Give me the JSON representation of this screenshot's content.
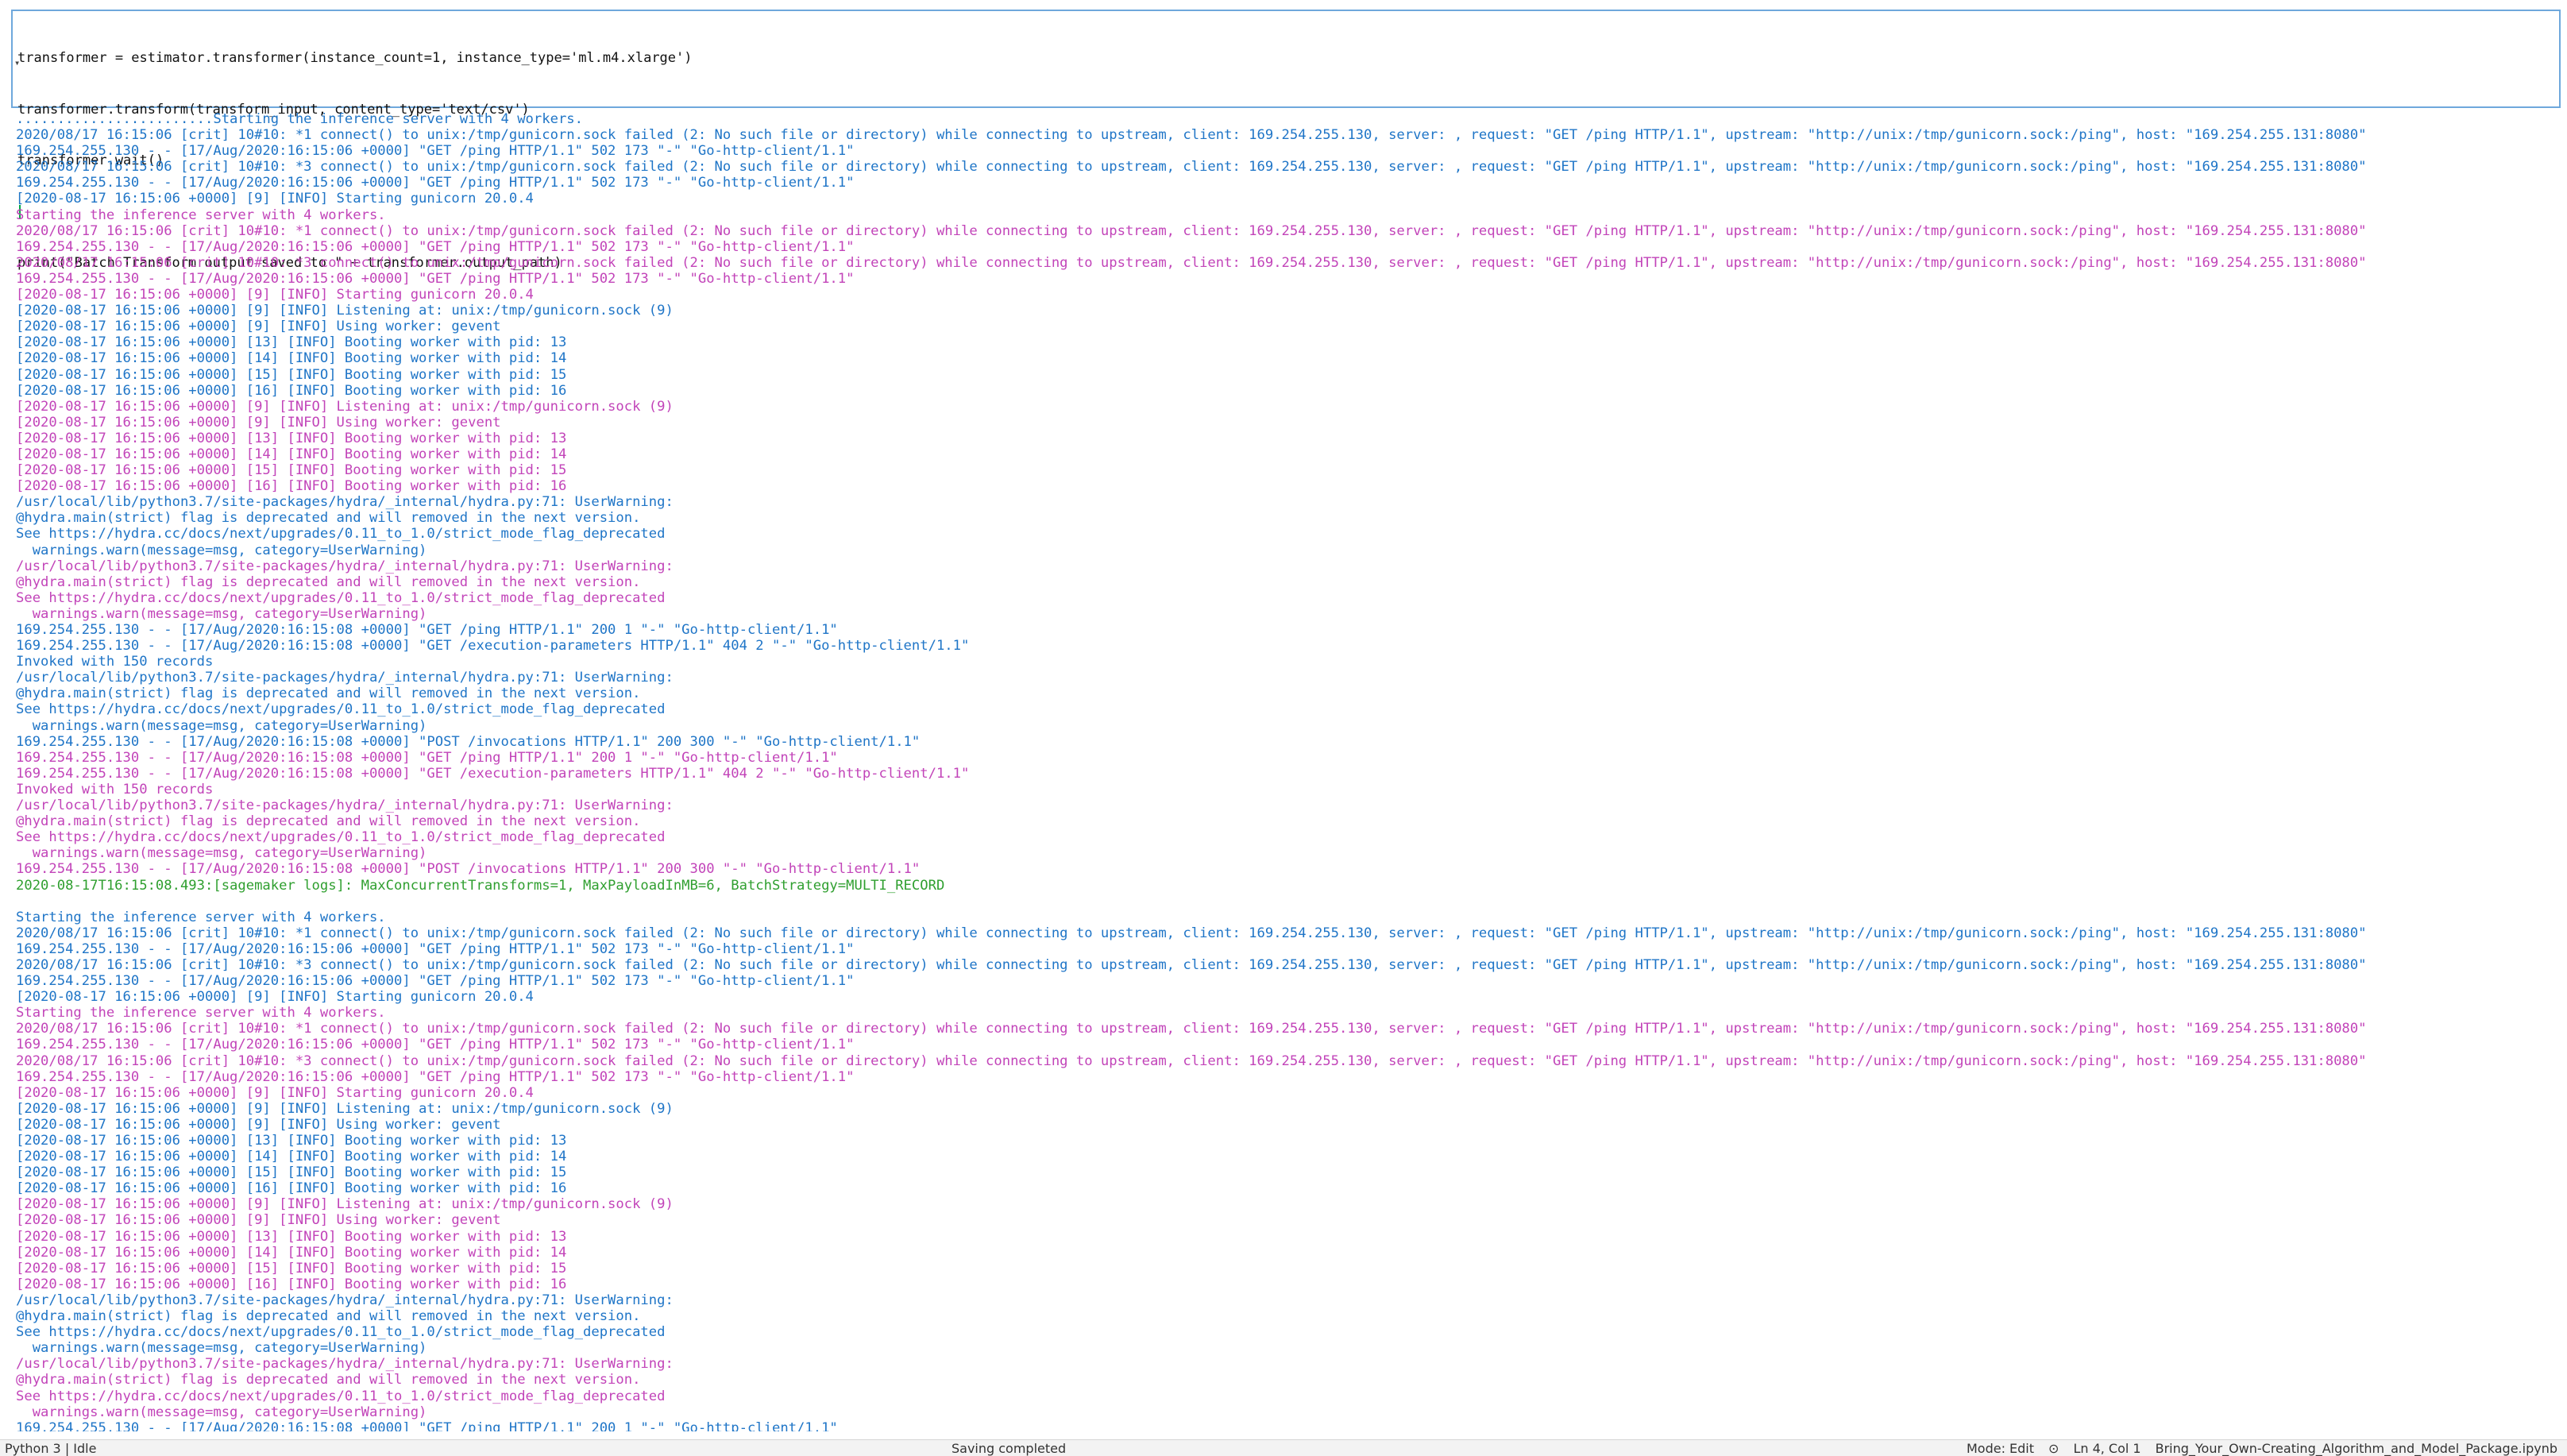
{
  "cell": {
    "code_lines": [
      "transformer = estimator.transformer(instance_count=1, instance_type='ml.m4.xlarge')",
      "transformer.transform(transform_input, content_type='text/csv')",
      "transformer.wait()",
      "",
      "print(\"Batch Transform output saved to \" + transformer.output_path)"
    ]
  },
  "output": {
    "lines": [
      {
        "text": "........................Starting the inference server with 4 workers.",
        "color": "blue"
      },
      {
        "text": "2020/08/17 16:15:06 [crit] 10#10: *1 connect() to unix:/tmp/gunicorn.sock failed (2: No such file or directory) while connecting to upstream, client: 169.254.255.130, server: , request: \"GET /ping HTTP/1.1\", upstream: \"http://unix:/tmp/gunicorn.sock:/ping\", host: \"169.254.255.131:8080\"",
        "color": "blue"
      },
      {
        "text": "169.254.255.130 - - [17/Aug/2020:16:15:06 +0000] \"GET /ping HTTP/1.1\" 502 173 \"-\" \"Go-http-client/1.1\"",
        "color": "blue"
      },
      {
        "text": "2020/08/17 16:15:06 [crit] 10#10: *3 connect() to unix:/tmp/gunicorn.sock failed (2: No such file or directory) while connecting to upstream, client: 169.254.255.130, server: , request: \"GET /ping HTTP/1.1\", upstream: \"http://unix:/tmp/gunicorn.sock:/ping\", host: \"169.254.255.131:8080\"",
        "color": "blue"
      },
      {
        "text": "169.254.255.130 - - [17/Aug/2020:16:15:06 +0000] \"GET /ping HTTP/1.1\" 502 173 \"-\" \"Go-http-client/1.1\"",
        "color": "blue"
      },
      {
        "text": "[2020-08-17 16:15:06 +0000] [9] [INFO] Starting gunicorn 20.0.4",
        "color": "blue"
      },
      {
        "text": "Starting the inference server with 4 workers.",
        "color": "mag"
      },
      {
        "text": "2020/08/17 16:15:06 [crit] 10#10: *1 connect() to unix:/tmp/gunicorn.sock failed (2: No such file or directory) while connecting to upstream, client: 169.254.255.130, server: , request: \"GET /ping HTTP/1.1\", upstream: \"http://unix:/tmp/gunicorn.sock:/ping\", host: \"169.254.255.131:8080\"",
        "color": "mag"
      },
      {
        "text": "169.254.255.130 - - [17/Aug/2020:16:15:06 +0000] \"GET /ping HTTP/1.1\" 502 173 \"-\" \"Go-http-client/1.1\"",
        "color": "mag"
      },
      {
        "text": "2020/08/17 16:15:06 [crit] 10#10: *3 connect() to unix:/tmp/gunicorn.sock failed (2: No such file or directory) while connecting to upstream, client: 169.254.255.130, server: , request: \"GET /ping HTTP/1.1\", upstream: \"http://unix:/tmp/gunicorn.sock:/ping\", host: \"169.254.255.131:8080\"",
        "color": "mag"
      },
      {
        "text": "169.254.255.130 - - [17/Aug/2020:16:15:06 +0000] \"GET /ping HTTP/1.1\" 502 173 \"-\" \"Go-http-client/1.1\"",
        "color": "mag"
      },
      {
        "text": "[2020-08-17 16:15:06 +0000] [9] [INFO] Starting gunicorn 20.0.4",
        "color": "mag"
      },
      {
        "text": "[2020-08-17 16:15:06 +0000] [9] [INFO] Listening at: unix:/tmp/gunicorn.sock (9)",
        "color": "blue"
      },
      {
        "text": "[2020-08-17 16:15:06 +0000] [9] [INFO] Using worker: gevent",
        "color": "blue"
      },
      {
        "text": "[2020-08-17 16:15:06 +0000] [13] [INFO] Booting worker with pid: 13",
        "color": "blue"
      },
      {
        "text": "[2020-08-17 16:15:06 +0000] [14] [INFO] Booting worker with pid: 14",
        "color": "blue"
      },
      {
        "text": "[2020-08-17 16:15:06 +0000] [15] [INFO] Booting worker with pid: 15",
        "color": "blue"
      },
      {
        "text": "[2020-08-17 16:15:06 +0000] [16] [INFO] Booting worker with pid: 16",
        "color": "blue"
      },
      {
        "text": "[2020-08-17 16:15:06 +0000] [9] [INFO] Listening at: unix:/tmp/gunicorn.sock (9)",
        "color": "mag"
      },
      {
        "text": "[2020-08-17 16:15:06 +0000] [9] [INFO] Using worker: gevent",
        "color": "mag"
      },
      {
        "text": "[2020-08-17 16:15:06 +0000] [13] [INFO] Booting worker with pid: 13",
        "color": "mag"
      },
      {
        "text": "[2020-08-17 16:15:06 +0000] [14] [INFO] Booting worker with pid: 14",
        "color": "mag"
      },
      {
        "text": "[2020-08-17 16:15:06 +0000] [15] [INFO] Booting worker with pid: 15",
        "color": "mag"
      },
      {
        "text": "[2020-08-17 16:15:06 +0000] [16] [INFO] Booting worker with pid: 16",
        "color": "mag"
      },
      {
        "text": "/usr/local/lib/python3.7/site-packages/hydra/_internal/hydra.py:71: UserWarning:",
        "color": "blue"
      },
      {
        "text": "@hydra.main(strict) flag is deprecated and will removed in the next version.",
        "color": "blue"
      },
      {
        "text": "See https://hydra.cc/docs/next/upgrades/0.11_to_1.0/strict_mode_flag_deprecated",
        "color": "blue"
      },
      {
        "text": "  warnings.warn(message=msg, category=UserWarning)",
        "color": "blue"
      },
      {
        "text": "/usr/local/lib/python3.7/site-packages/hydra/_internal/hydra.py:71: UserWarning:",
        "color": "mag"
      },
      {
        "text": "@hydra.main(strict) flag is deprecated and will removed in the next version.",
        "color": "mag"
      },
      {
        "text": "See https://hydra.cc/docs/next/upgrades/0.11_to_1.0/strict_mode_flag_deprecated",
        "color": "mag"
      },
      {
        "text": "  warnings.warn(message=msg, category=UserWarning)",
        "color": "mag"
      },
      {
        "text": "169.254.255.130 - - [17/Aug/2020:16:15:08 +0000] \"GET /ping HTTP/1.1\" 200 1 \"-\" \"Go-http-client/1.1\"",
        "color": "blue"
      },
      {
        "text": "169.254.255.130 - - [17/Aug/2020:16:15:08 +0000] \"GET /execution-parameters HTTP/1.1\" 404 2 \"-\" \"Go-http-client/1.1\"",
        "color": "blue"
      },
      {
        "text": "Invoked with 150 records",
        "color": "blue"
      },
      {
        "text": "/usr/local/lib/python3.7/site-packages/hydra/_internal/hydra.py:71: UserWarning:",
        "color": "blue"
      },
      {
        "text": "@hydra.main(strict) flag is deprecated and will removed in the next version.",
        "color": "blue"
      },
      {
        "text": "See https://hydra.cc/docs/next/upgrades/0.11_to_1.0/strict_mode_flag_deprecated",
        "color": "blue"
      },
      {
        "text": "  warnings.warn(message=msg, category=UserWarning)",
        "color": "blue"
      },
      {
        "text": "169.254.255.130 - - [17/Aug/2020:16:15:08 +0000] \"POST /invocations HTTP/1.1\" 200 300 \"-\" \"Go-http-client/1.1\"",
        "color": "blue"
      },
      {
        "text": "169.254.255.130 - - [17/Aug/2020:16:15:08 +0000] \"GET /ping HTTP/1.1\" 200 1 \"-\" \"Go-http-client/1.1\"",
        "color": "mag"
      },
      {
        "text": "169.254.255.130 - - [17/Aug/2020:16:15:08 +0000] \"GET /execution-parameters HTTP/1.1\" 404 2 \"-\" \"Go-http-client/1.1\"",
        "color": "mag"
      },
      {
        "text": "Invoked with 150 records",
        "color": "mag"
      },
      {
        "text": "/usr/local/lib/python3.7/site-packages/hydra/_internal/hydra.py:71: UserWarning:",
        "color": "mag"
      },
      {
        "text": "@hydra.main(strict) flag is deprecated and will removed in the next version.",
        "color": "mag"
      },
      {
        "text": "See https://hydra.cc/docs/next/upgrades/0.11_to_1.0/strict_mode_flag_deprecated",
        "color": "mag"
      },
      {
        "text": "  warnings.warn(message=msg, category=UserWarning)",
        "color": "mag"
      },
      {
        "text": "169.254.255.130 - - [17/Aug/2020:16:15:08 +0000] \"POST /invocations HTTP/1.1\" 200 300 \"-\" \"Go-http-client/1.1\"",
        "color": "mag"
      },
      {
        "text": "2020-08-17T16:15:08.493:[sagemaker logs]: MaxConcurrentTransforms=1, MaxPayloadInMB=6, BatchStrategy=MULTI_RECORD",
        "color": "green"
      },
      {
        "text": "",
        "color": "blank"
      },
      {
        "text": "Starting the inference server with 4 workers.",
        "color": "blue"
      },
      {
        "text": "2020/08/17 16:15:06 [crit] 10#10: *1 connect() to unix:/tmp/gunicorn.sock failed (2: No such file or directory) while connecting to upstream, client: 169.254.255.130, server: , request: \"GET /ping HTTP/1.1\", upstream: \"http://unix:/tmp/gunicorn.sock:/ping\", host: \"169.254.255.131:8080\"",
        "color": "blue"
      },
      {
        "text": "169.254.255.130 - - [17/Aug/2020:16:15:06 +0000] \"GET /ping HTTP/1.1\" 502 173 \"-\" \"Go-http-client/1.1\"",
        "color": "blue"
      },
      {
        "text": "2020/08/17 16:15:06 [crit] 10#10: *3 connect() to unix:/tmp/gunicorn.sock failed (2: No such file or directory) while connecting to upstream, client: 169.254.255.130, server: , request: \"GET /ping HTTP/1.1\", upstream: \"http://unix:/tmp/gunicorn.sock:/ping\", host: \"169.254.255.131:8080\"",
        "color": "blue"
      },
      {
        "text": "169.254.255.130 - - [17/Aug/2020:16:15:06 +0000] \"GET /ping HTTP/1.1\" 502 173 \"-\" \"Go-http-client/1.1\"",
        "color": "blue"
      },
      {
        "text": "[2020-08-17 16:15:06 +0000] [9] [INFO] Starting gunicorn 20.0.4",
        "color": "blue"
      },
      {
        "text": "Starting the inference server with 4 workers.",
        "color": "mag"
      },
      {
        "text": "2020/08/17 16:15:06 [crit] 10#10: *1 connect() to unix:/tmp/gunicorn.sock failed (2: No such file or directory) while connecting to upstream, client: 169.254.255.130, server: , request: \"GET /ping HTTP/1.1\", upstream: \"http://unix:/tmp/gunicorn.sock:/ping\", host: \"169.254.255.131:8080\"",
        "color": "mag"
      },
      {
        "text": "169.254.255.130 - - [17/Aug/2020:16:15:06 +0000] \"GET /ping HTTP/1.1\" 502 173 \"-\" \"Go-http-client/1.1\"",
        "color": "mag"
      },
      {
        "text": "2020/08/17 16:15:06 [crit] 10#10: *3 connect() to unix:/tmp/gunicorn.sock failed (2: No such file or directory) while connecting to upstream, client: 169.254.255.130, server: , request: \"GET /ping HTTP/1.1\", upstream: \"http://unix:/tmp/gunicorn.sock:/ping\", host: \"169.254.255.131:8080\"",
        "color": "mag"
      },
      {
        "text": "169.254.255.130 - - [17/Aug/2020:16:15:06 +0000] \"GET /ping HTTP/1.1\" 502 173 \"-\" \"Go-http-client/1.1\"",
        "color": "mag"
      },
      {
        "text": "[2020-08-17 16:15:06 +0000] [9] [INFO] Starting gunicorn 20.0.4",
        "color": "mag"
      },
      {
        "text": "[2020-08-17 16:15:06 +0000] [9] [INFO] Listening at: unix:/tmp/gunicorn.sock (9)",
        "color": "blue"
      },
      {
        "text": "[2020-08-17 16:15:06 +0000] [9] [INFO] Using worker: gevent",
        "color": "blue"
      },
      {
        "text": "[2020-08-17 16:15:06 +0000] [13] [INFO] Booting worker with pid: 13",
        "color": "blue"
      },
      {
        "text": "[2020-08-17 16:15:06 +0000] [14] [INFO] Booting worker with pid: 14",
        "color": "blue"
      },
      {
        "text": "[2020-08-17 16:15:06 +0000] [15] [INFO] Booting worker with pid: 15",
        "color": "blue"
      },
      {
        "text": "[2020-08-17 16:15:06 +0000] [16] [INFO] Booting worker with pid: 16",
        "color": "blue"
      },
      {
        "text": "[2020-08-17 16:15:06 +0000] [9] [INFO] Listening at: unix:/tmp/gunicorn.sock (9)",
        "color": "mag"
      },
      {
        "text": "[2020-08-17 16:15:06 +0000] [9] [INFO] Using worker: gevent",
        "color": "mag"
      },
      {
        "text": "[2020-08-17 16:15:06 +0000] [13] [INFO] Booting worker with pid: 13",
        "color": "mag"
      },
      {
        "text": "[2020-08-17 16:15:06 +0000] [14] [INFO] Booting worker with pid: 14",
        "color": "mag"
      },
      {
        "text": "[2020-08-17 16:15:06 +0000] [15] [INFO] Booting worker with pid: 15",
        "color": "mag"
      },
      {
        "text": "[2020-08-17 16:15:06 +0000] [16] [INFO] Booting worker with pid: 16",
        "color": "mag"
      },
      {
        "text": "/usr/local/lib/python3.7/site-packages/hydra/_internal/hydra.py:71: UserWarning:",
        "color": "blue"
      },
      {
        "text": "@hydra.main(strict) flag is deprecated and will removed in the next version.",
        "color": "blue"
      },
      {
        "text": "See https://hydra.cc/docs/next/upgrades/0.11_to_1.0/strict_mode_flag_deprecated",
        "color": "blue"
      },
      {
        "text": "  warnings.warn(message=msg, category=UserWarning)",
        "color": "blue"
      },
      {
        "text": "/usr/local/lib/python3.7/site-packages/hydra/_internal/hydra.py:71: UserWarning:",
        "color": "mag"
      },
      {
        "text": "@hydra.main(strict) flag is deprecated and will removed in the next version.",
        "color": "mag"
      },
      {
        "text": "See https://hydra.cc/docs/next/upgrades/0.11_to_1.0/strict_mode_flag_deprecated",
        "color": "mag"
      },
      {
        "text": "  warnings.warn(message=msg, category=UserWarning)",
        "color": "mag"
      },
      {
        "text": "169.254.255.130 - - [17/Aug/2020:16:15:08 +0000] \"GET /ping HTTP/1.1\" 200 1 \"-\" \"Go-http-client/1.1\"",
        "color": "blue"
      }
    ]
  },
  "statusbar": {
    "kernel": "Python 3 | Idle",
    "save_status": "Saving completed",
    "mode": "Mode: Edit",
    "position": "Ln 4, Col 1",
    "filename": "Bring_Your_Own-Creating_Algorithm_and_Model_Package.ipynb"
  },
  "colors": {
    "blue": "#1f75c7",
    "magenta": "#c244b9",
    "green": "#2f9f2f",
    "cell_border": "#6fa8dc"
  }
}
